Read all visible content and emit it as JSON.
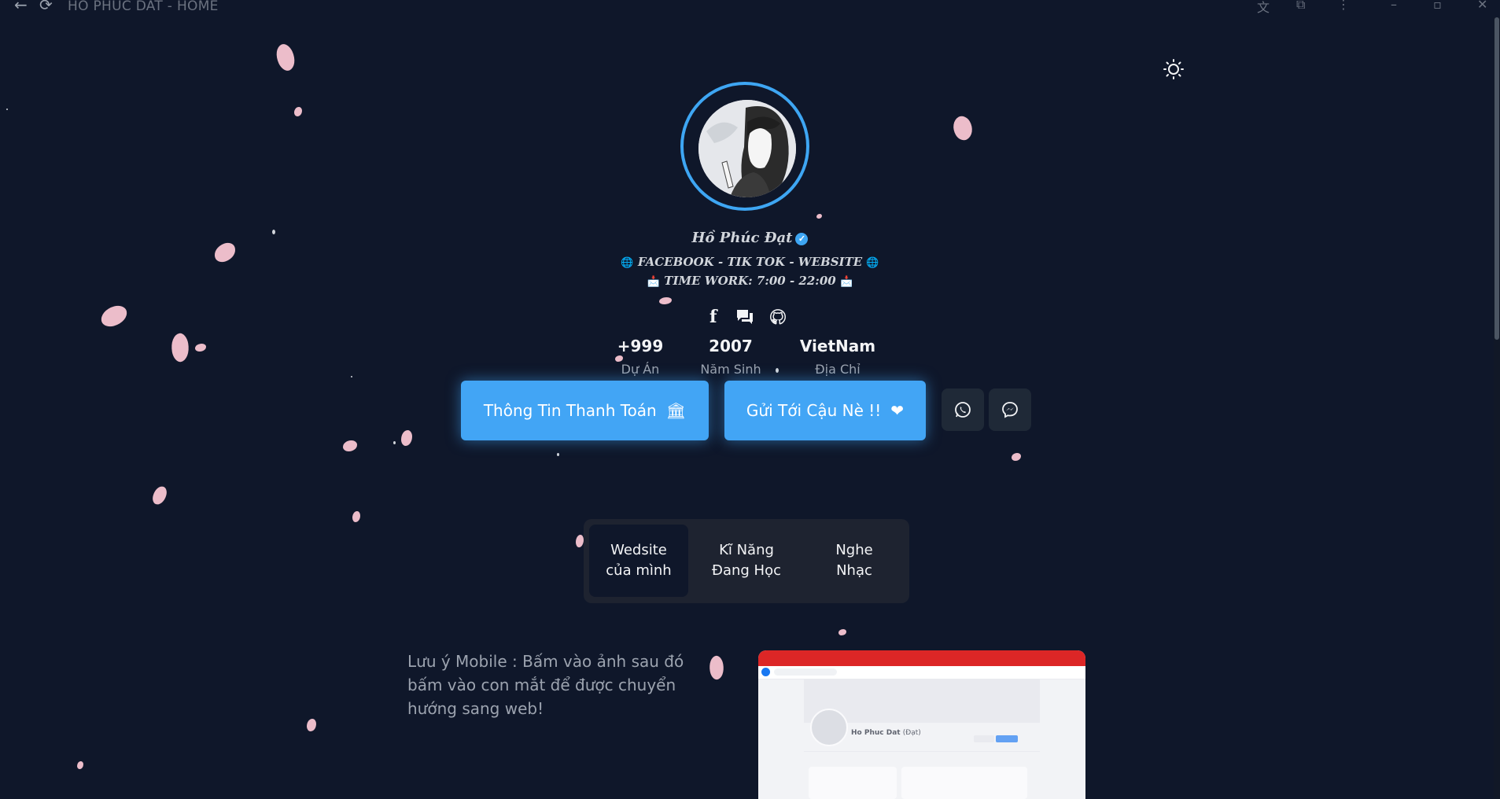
{
  "window": {
    "title": "HO PHUC DAT - HOME",
    "back_icon": "back-arrow-icon",
    "reload_icon": "reload-icon"
  },
  "profile": {
    "name": "Hồ Phúc Đạt",
    "bio_line1": "FACEBOOK - TIK TOK - WEBSITE",
    "bio_line2": "TIME WORK: 7:00 - 22:00",
    "accent_color": "#3ea6f3"
  },
  "socials": [
    "facebook-icon",
    "chat-icon",
    "github-icon"
  ],
  "stats": [
    {
      "value": "+999",
      "label": "Dự Án"
    },
    {
      "value": "2007",
      "label": "Năm Sinh"
    },
    {
      "value": "VietNam",
      "label": "Địa Chỉ"
    }
  ],
  "actions": {
    "payment_label": "Thông Tin Thanh Toán",
    "send_label": "Gửi Tới Cậu Nè !!",
    "whatsapp_icon": "whatsapp-icon",
    "messenger_icon": "messenger-icon"
  },
  "tabs": [
    {
      "line1": "Wedsite",
      "line2": "của mình",
      "active": true
    },
    {
      "line1": "Kĩ Năng",
      "line2": "Đang Học",
      "active": false
    },
    {
      "line1": "Nghe",
      "line2": "Nhạc",
      "active": false
    }
  ],
  "content": {
    "note": "Lưu ý Mobile : Bấm vào ảnh sau đó bấm vào con mắt để được chuyển hướng sang web!",
    "preview": {
      "name": "Ho Phuc Dat",
      "name_suffix": "(Đạt)"
    }
  },
  "colors": {
    "background": "#0f172a",
    "button": "#42a5f5",
    "petal": "#f9c6d3"
  }
}
